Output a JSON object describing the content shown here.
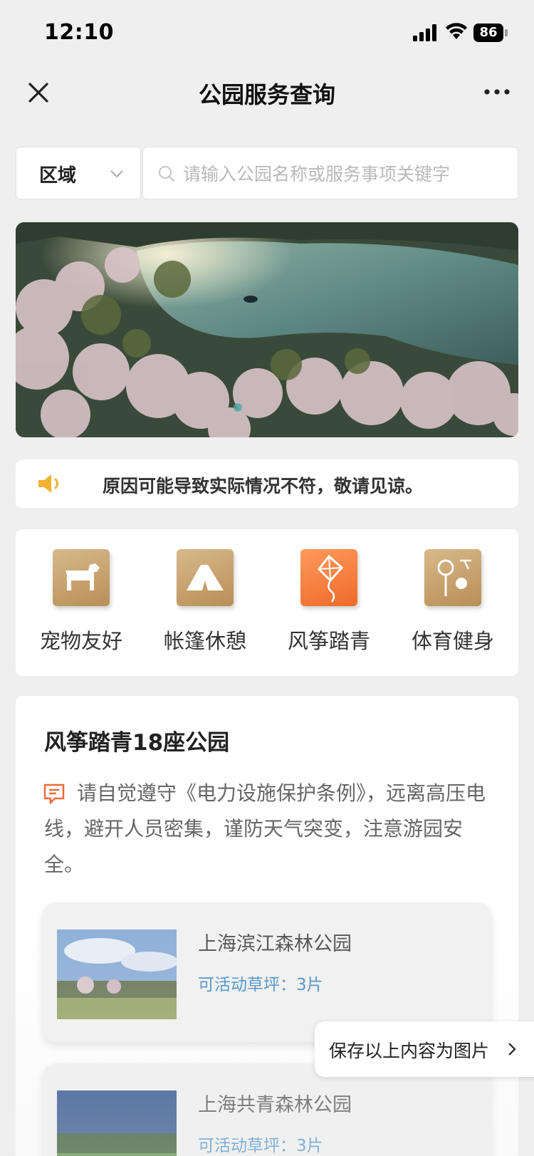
{
  "status_bar": {
    "time": "12:10",
    "battery": "86"
  },
  "nav": {
    "title": "公园服务查询",
    "close_icon": "close-icon",
    "more_icon": "more-icon"
  },
  "filter": {
    "region_label": "区域",
    "search_placeholder": "请输入公园名称或服务事项关键字",
    "search_value": ""
  },
  "notice": {
    "text": "原因可能导致实际情况不符，敬请见谅。"
  },
  "services": [
    {
      "label": "宠物友好",
      "icon": "dog-icon",
      "color": "#c9a46c"
    },
    {
      "label": "帐篷休憩",
      "icon": "tent-icon",
      "color": "#c9a46c"
    },
    {
      "label": "风筝踏青",
      "icon": "kite-icon",
      "color": "#f27a3c",
      "active": true
    },
    {
      "label": "体育健身",
      "icon": "racket-icon",
      "color": "#c9a46c"
    }
  ],
  "list": {
    "heading": "风筝踏青18座公园",
    "tip": "请自觉遵守《电力设施保护条例》，远离高压电线，避开人员密集，谨防天气突变，注意游园安全。",
    "parks": [
      {
        "name": "上海滨江森林公园",
        "area": "可活动草坪：3片"
      },
      {
        "name": "上海共青森林公园",
        "area": "可活动草坪：3片"
      }
    ]
  },
  "save_tag": {
    "label": "保存以上内容为图片"
  },
  "colors": {
    "accent_gold": "#c9a46c",
    "accent_orange": "#f27a3c",
    "link_blue": "#4a90c8"
  }
}
